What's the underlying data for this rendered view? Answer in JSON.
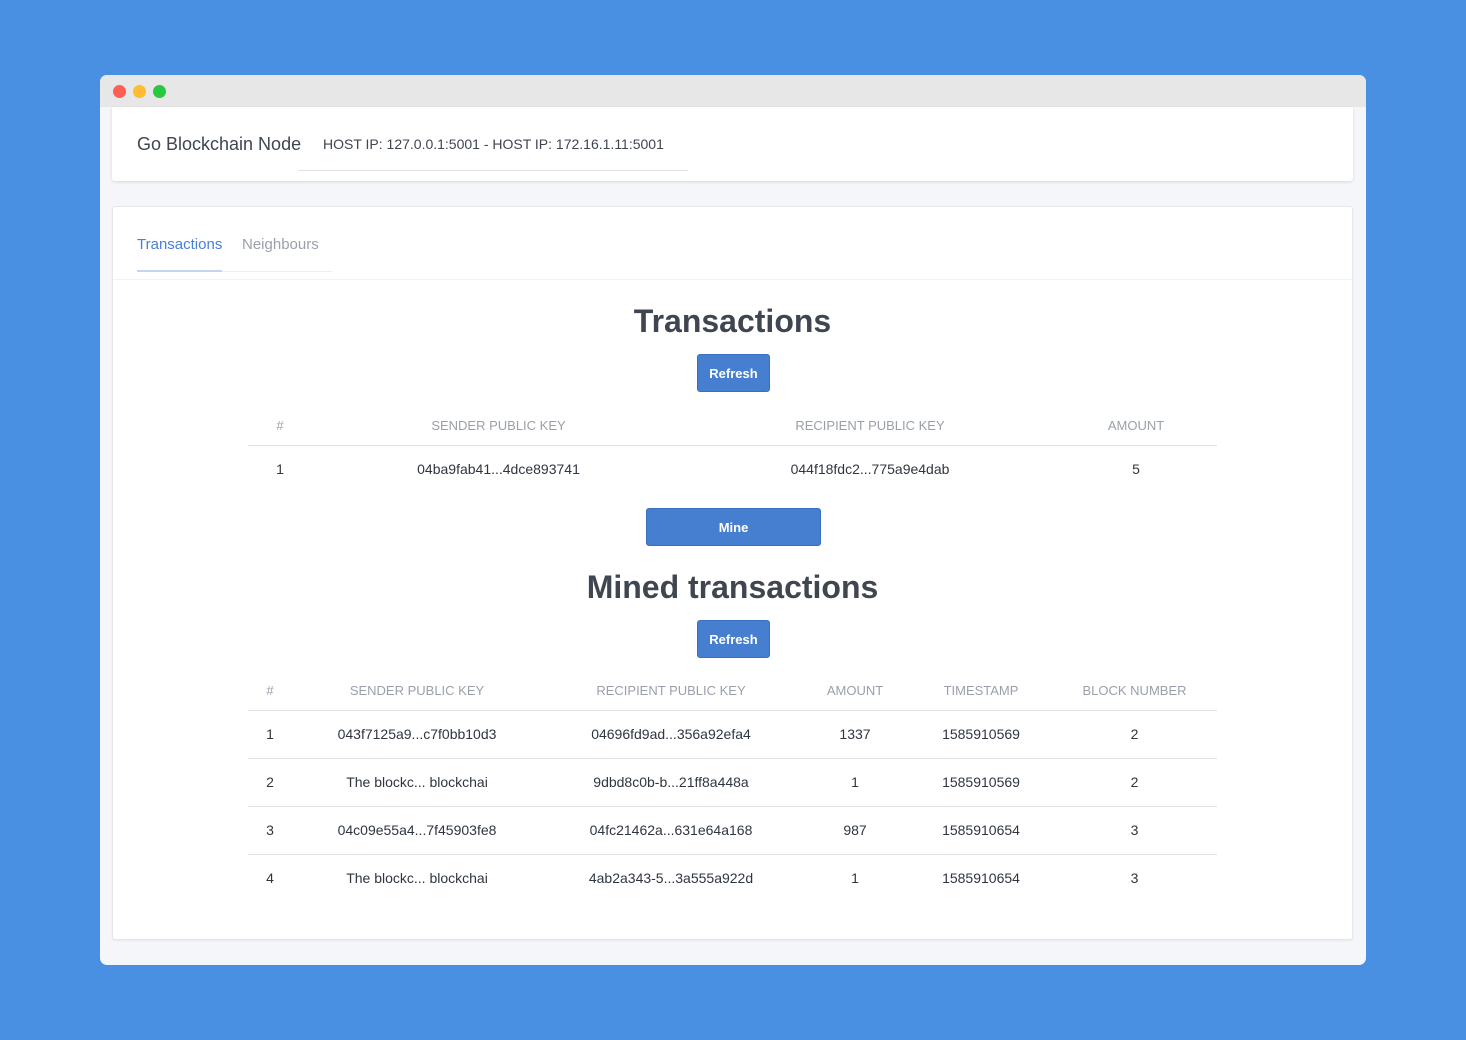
{
  "window": {
    "controls": [
      "close",
      "minimize",
      "maximize"
    ]
  },
  "header": {
    "title": "Go Blockchain Node",
    "host_ip": "HOST IP: 127.0.0.1:5001 - HOST IP: 172.16.1.11:5001"
  },
  "tabs": [
    {
      "label": "Transactions",
      "active": true
    },
    {
      "label": "Neighbours",
      "active": false
    }
  ],
  "transactions": {
    "title": "Transactions",
    "refresh_label": "Refresh",
    "columns": [
      "#",
      "SENDER PUBLIC KEY",
      "RECIPIENT PUBLIC KEY",
      "AMOUNT"
    ],
    "rows": [
      [
        "1",
        "04ba9fab41...4dce893741",
        "044f18fdc2...775a9e4dab",
        "5"
      ]
    ]
  },
  "mine_label": "Mine",
  "mined": {
    "title": "Mined transactions",
    "refresh_label": "Refresh",
    "columns": [
      "#",
      "SENDER PUBLIC KEY",
      "RECIPIENT PUBLIC KEY",
      "AMOUNT",
      "TIMESTAMP",
      "BLOCK NUMBER"
    ],
    "rows": [
      [
        "1",
        "043f7125a9...c7f0bb10d3",
        "04696fd9ad...356a92efa4",
        "1337",
        "1585910569",
        "2"
      ],
      [
        "2",
        "The blockc... blockchai",
        "9dbd8c0b-b...21ff8a448a",
        "1",
        "1585910569",
        "2"
      ],
      [
        "3",
        "04c09e55a4...7f45903fe8",
        "04fc21462a...631e64a168",
        "987",
        "1585910654",
        "3"
      ],
      [
        "4",
        "The blockc... blockchai",
        "4ab2a343-5...3a555a922d",
        "1",
        "1585910654",
        "3"
      ]
    ]
  }
}
